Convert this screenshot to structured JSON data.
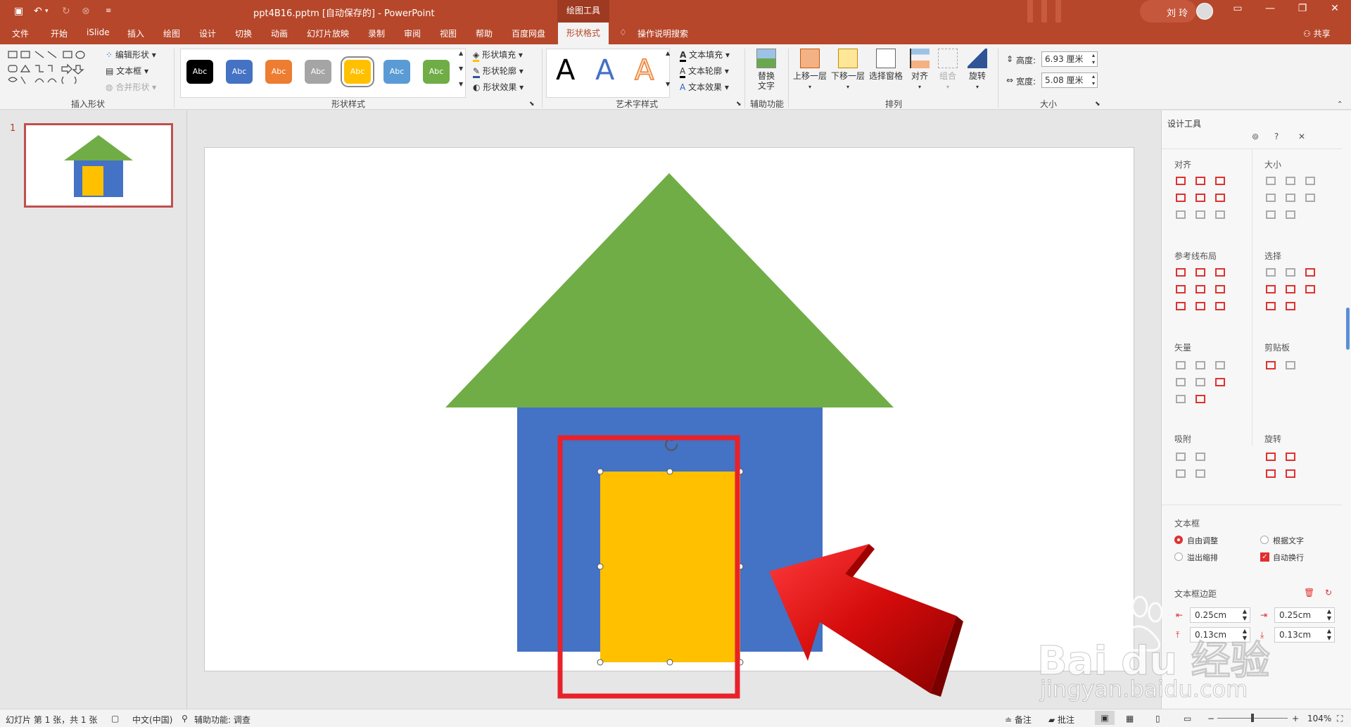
{
  "window": {
    "doc_title": "ppt4B16.pptm [自动保存的]  -  PowerPoint",
    "context_tab": "绘图工具",
    "user": "刘 玲",
    "theme_color": "#b7472a"
  },
  "tabs": [
    "文件",
    "开始",
    "iSlide",
    "插入",
    "绘图",
    "设计",
    "切换",
    "动画",
    "幻灯片放映",
    "录制",
    "审阅",
    "视图",
    "帮助",
    "百度网盘"
  ],
  "active_tab": "形状格式",
  "tell_me": "操作说明搜索",
  "share": "共享",
  "ribbon": {
    "insert_shapes": {
      "label": "插入形状",
      "edit_shape": "编辑形状",
      "textbox": "文本框",
      "merge": "合并形状"
    },
    "shape_styles": {
      "label": "形状样式",
      "swatch_text": "Abc",
      "swatches": [
        "#000000",
        "#4472c4",
        "#ed7d31",
        "#a5a5a5",
        "#ffc000",
        "#5b9bd5",
        "#70ad47"
      ],
      "fill": "形状填充",
      "outline": "形状轮廓",
      "effects": "形状效果"
    },
    "wordart": {
      "label": "艺术字样式",
      "text_fill": "文本填充",
      "text_outline": "文本轮廓",
      "text_effects": "文本效果",
      "letter": "A"
    },
    "accessibility": {
      "label": "辅助功能",
      "alt_text_1": "替换",
      "alt_text_2": "文字"
    },
    "arrange": {
      "label": "排列",
      "bring_forward": "上移一层",
      "send_backward": "下移一层",
      "selection_pane": "选择窗格",
      "align": "对齐",
      "group": "组合",
      "rotate": "旋转"
    },
    "size": {
      "label": "大小",
      "height_label": "高度:",
      "height_value": "6.93 厘米",
      "width_label": "宽度:",
      "width_value": "5.08 厘米"
    }
  },
  "slides": {
    "number": "1"
  },
  "design_pane": {
    "title": "设计工具",
    "align": "对齐",
    "size": "大小",
    "guides": "参考线布局",
    "select": "选择",
    "vector": "矢量",
    "clipboard": "剪贴板",
    "snap": "吸附",
    "rotate": "旋转",
    "textbox": "文本框",
    "auto_adjust": "自由调整",
    "fit_text": "根据文字",
    "overflow": "溢出缩排",
    "wrap": "自动换行",
    "margins": "文本框边距",
    "margin_left": "0.25cm",
    "margin_right": "0.25cm",
    "margin_top": "0.13cm",
    "margin_bottom": "0.13cm"
  },
  "status": {
    "slide_info": "幻灯片 第 1 张，共 1 张",
    "language": "中文(中国)",
    "accessibility": "辅助功能: 调查",
    "notes": "备注",
    "comments": "批注",
    "zoom": "104%"
  },
  "colors": {
    "roof": "#70ad47",
    "wall": "#4472c4",
    "door": "#ffc000",
    "highlight": "#e8212a",
    "arrow": "#e01010"
  },
  "watermark": {
    "brand": "Bai du 经验",
    "url": "jingyan.baidu.com"
  }
}
